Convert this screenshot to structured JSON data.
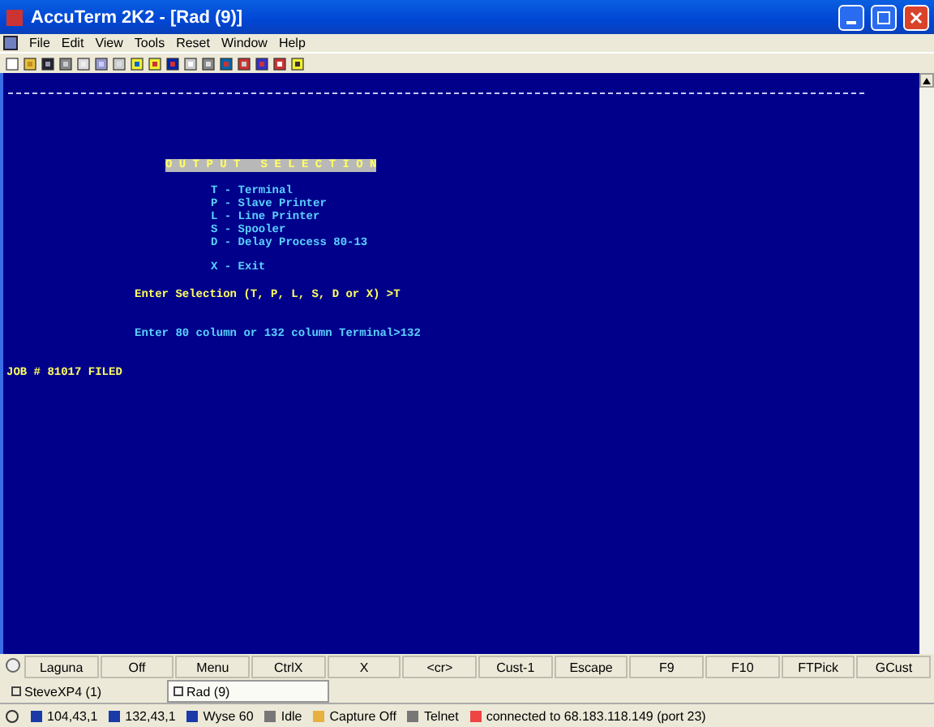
{
  "window": {
    "title": "AccuTerm 2K2 - [Rad (9)]"
  },
  "menu": [
    "File",
    "Edit",
    "View",
    "Tools",
    "Reset",
    "Window",
    "Help"
  ],
  "terminal": {
    "menu_title": "O U T P U T   S E L E C T I O N",
    "options": [
      "T - Terminal",
      "P - Slave Printer",
      "L - Line Printer",
      "S - Spooler",
      "D - Delay Process 80-13"
    ],
    "exit_option": "X - Exit",
    "selection_prompt": "Enter Selection (T, P, L, S, D or X) >T",
    "column_prompt": "Enter 80 column or 132 column Terminal>132",
    "job_message": "JOB # 81017 FILED"
  },
  "function_keys": [
    "Laguna",
    "Off",
    "Menu",
    "CtrlX",
    "X",
    "<cr>",
    "Cust-1",
    "Escape",
    "F9",
    "F10",
    "FTPick",
    "GCust"
  ],
  "tabs": [
    {
      "label": "SteveXP4 (1)",
      "selected": false
    },
    {
      "label": "Rad (9)",
      "selected": true
    }
  ],
  "status_bar": [
    "104,43,1",
    "132,43,1",
    "Wyse 60",
    "Idle",
    "Capture Off",
    "Telnet",
    "connected to 68.183.118.149 (port 23)"
  ]
}
